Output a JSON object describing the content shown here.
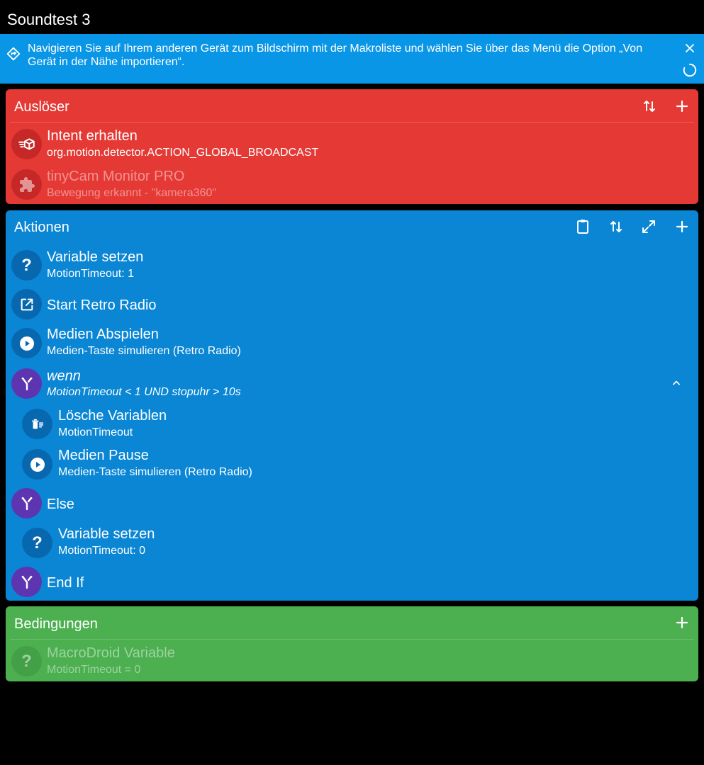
{
  "window": {
    "title": "Soundtest 3"
  },
  "banner": {
    "message": "Navigieren Sie auf Ihrem anderen Gerät zum Bildschirm mit der Makroliste und wählen Sie über das Menü die Option „Von Gerät in der Nähe importieren“.",
    "icons": {
      "leading": "navigation-diamond-icon",
      "close": "close-icon",
      "progress": "spinner-icon"
    }
  },
  "triggers": {
    "title": "Auslöser",
    "items": [
      {
        "title": "Intent erhalten",
        "subtitle": "org.motion.detector.ACTION_GLOBAL_BROADCAST",
        "icon": "intent-icon",
        "enabled": true
      },
      {
        "title": "tinyCam Monitor PRO",
        "subtitle": "Bewegung erkannt - \"kamera360\"",
        "icon": "plugin-icon",
        "enabled": false
      }
    ]
  },
  "actions": {
    "title": "Aktionen",
    "items": [
      {
        "title": "Variable setzen",
        "subtitle": "MotionTimeout: 1",
        "icon": "question-icon"
      },
      {
        "title": "Start Retro Radio",
        "subtitle": "",
        "icon": "launch-app-icon"
      },
      {
        "title": "Medien Abspielen",
        "subtitle": "Medien-Taste simulieren (Retro Radio)",
        "icon": "play-icon"
      },
      {
        "title": "wenn",
        "subtitle": "MotionTimeout < 1 UND stopuhr > 10s",
        "icon": "branch-icon"
      },
      {
        "title": "Lösche Variablen",
        "subtitle": "MotionTimeout",
        "icon": "delete-variable-icon"
      },
      {
        "title": "Medien Pause",
        "subtitle": "Medien-Taste simulieren (Retro Radio)",
        "icon": "play-icon"
      },
      {
        "title": "Else",
        "subtitle": "",
        "icon": "branch-icon"
      },
      {
        "title": "Variable setzen",
        "subtitle": "MotionTimeout: 0",
        "icon": "question-icon"
      },
      {
        "title": "End If",
        "subtitle": "",
        "icon": "branch-icon"
      }
    ]
  },
  "constraints": {
    "title": "Bedingungen",
    "items": [
      {
        "title": "MacroDroid Variable",
        "subtitle": "MotionTimeout = 0",
        "icon": "question-icon",
        "enabled": false
      }
    ]
  },
  "colors": {
    "triggers": "#e53935",
    "actions": "#0a86d4",
    "constraints": "#4caf50",
    "banner": "#0a96e6",
    "branch": "#5e35b1"
  }
}
